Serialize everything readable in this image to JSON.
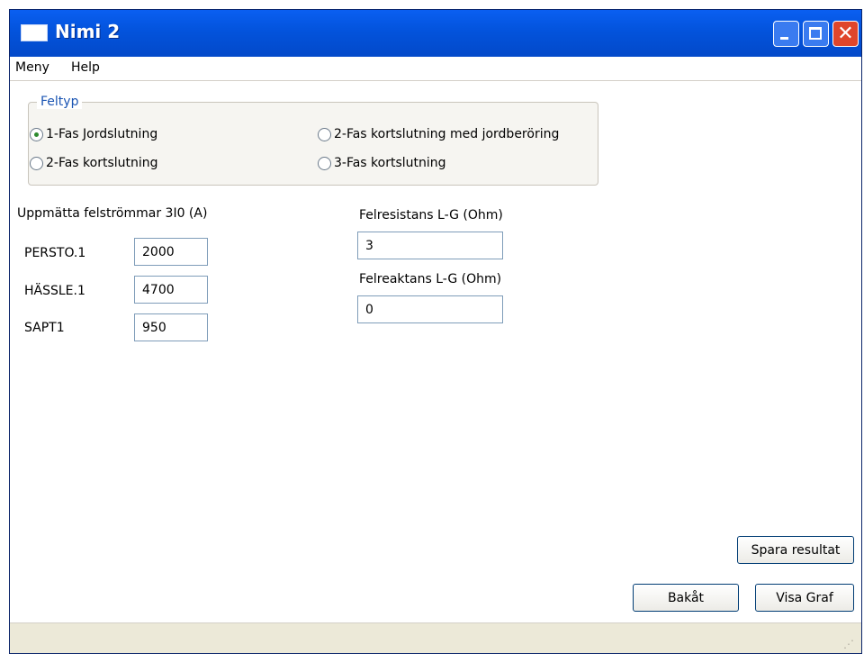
{
  "window": {
    "title": "Nimi 2"
  },
  "menu": {
    "items": [
      "Meny",
      "Help"
    ]
  },
  "feltyp": {
    "title": "Feltyp",
    "options": [
      {
        "label": "1-Fas Jordslutning",
        "selected": true
      },
      {
        "label": "2-Fas kortslutning med jordberöring",
        "selected": false
      },
      {
        "label": "2-Fas kortslutning",
        "selected": false
      },
      {
        "label": "3-Fas kortslutning",
        "selected": false
      }
    ]
  },
  "currents": {
    "heading": "Uppmätta felströmmar 3I0 (A)",
    "rows": [
      {
        "label": "PERSTO.1",
        "value": "2000"
      },
      {
        "label": "HÄSSLE.1",
        "value": "4700"
      },
      {
        "label": "SAPT1",
        "value": "950"
      }
    ]
  },
  "resistance": {
    "label": "Felresistans L-G (Ohm)",
    "value": "3"
  },
  "reactance": {
    "label": "Felreaktans L-G (Ohm)",
    "value": "0"
  },
  "buttons": {
    "save": "Spara resultat",
    "back": "Bakåt",
    "show_graph": "Visa Graf"
  },
  "colors": {
    "title_bar": "#0353dc",
    "group_title": "#1b55b3",
    "close_button": "#e0462b"
  }
}
